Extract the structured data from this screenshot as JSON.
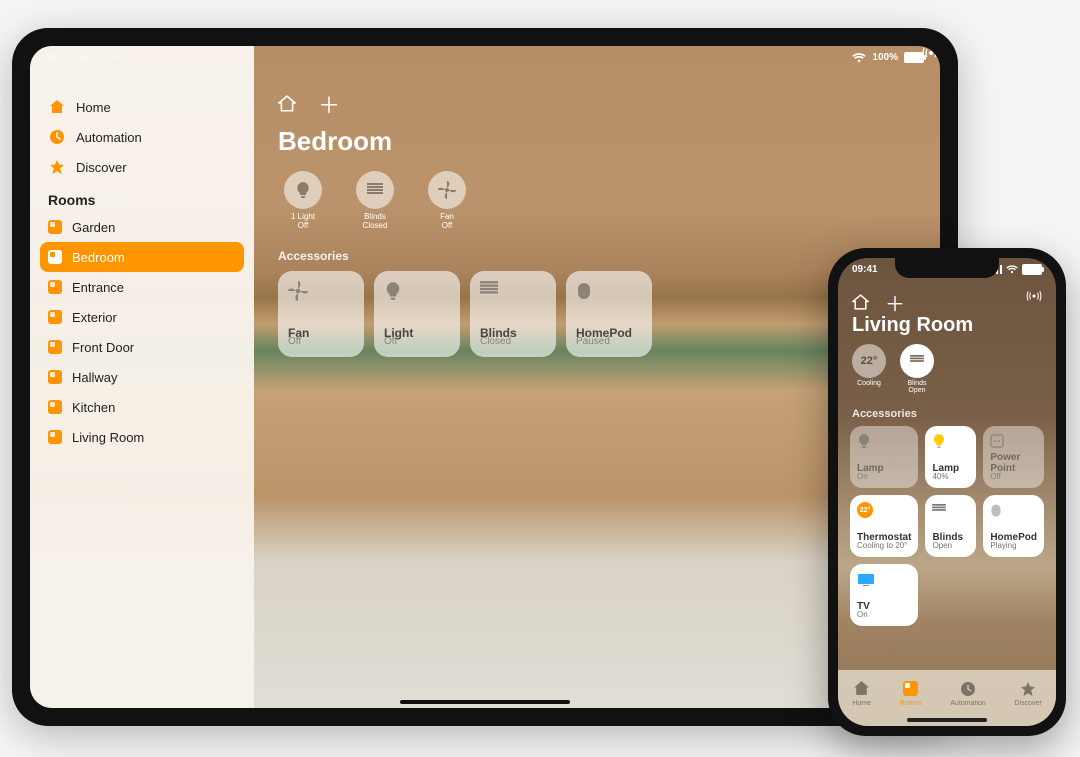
{
  "ipad": {
    "status": {
      "time": "09:41",
      "date": "Tue 13 Oct",
      "battery": "100%"
    },
    "sidebar": {
      "nav": [
        {
          "label": "Home",
          "icon": "house-icon"
        },
        {
          "label": "Automation",
          "icon": "clock-icon"
        },
        {
          "label": "Discover",
          "icon": "star-icon"
        }
      ],
      "rooms_header": "Rooms",
      "rooms": [
        {
          "label": "Garden"
        },
        {
          "label": "Bedroom",
          "selected": true
        },
        {
          "label": "Entrance"
        },
        {
          "label": "Exterior"
        },
        {
          "label": "Front Door"
        },
        {
          "label": "Hallway"
        },
        {
          "label": "Kitchen"
        },
        {
          "label": "Living Room"
        }
      ]
    },
    "main": {
      "title": "Bedroom",
      "status_circles": [
        {
          "icon": "bulb-icon",
          "label": "1 Light\nOff"
        },
        {
          "icon": "blinds-icon",
          "label": "Blinds\nClosed"
        },
        {
          "icon": "fan-icon",
          "label": "Fan\nOff"
        }
      ],
      "section_header": "Accessories",
      "tiles": [
        {
          "name": "Fan",
          "status": "Off",
          "icon": "fan-icon"
        },
        {
          "name": "Light",
          "status": "Off",
          "icon": "bulb-icon"
        },
        {
          "name": "Blinds",
          "status": "Closed",
          "icon": "blinds-icon"
        },
        {
          "name": "HomePod",
          "status": "Paused",
          "icon": "homepod-icon"
        }
      ]
    }
  },
  "iphone": {
    "status": {
      "time": "09:41"
    },
    "title": "Living Room",
    "status_circles": [
      {
        "value": "22°",
        "label": "Cooling"
      },
      {
        "icon": "blinds-icon",
        "label": "Blinds\nOpen"
      }
    ],
    "section_header": "Accessories",
    "tiles": [
      {
        "name": "Lamp",
        "status": "On",
        "state": "off",
        "icon": "bulb-icon"
      },
      {
        "name": "Lamp",
        "status": "40%",
        "state": "on",
        "icon": "bulb-on-icon",
        "accent": "#ffcc00"
      },
      {
        "name": "Power Point",
        "status": "Off",
        "state": "off",
        "icon": "outlet-icon"
      },
      {
        "name": "Thermostat",
        "status": "Cooling to 20°",
        "state": "on",
        "icon": "thermostat-icon",
        "accent": "#ff9500"
      },
      {
        "name": "Blinds",
        "status": "Open",
        "state": "on",
        "icon": "blinds-icon"
      },
      {
        "name": "HomePod",
        "status": "Playing",
        "state": "on",
        "icon": "homepod-icon"
      },
      {
        "name": "TV",
        "status": "On",
        "state": "on",
        "icon": "tv-icon",
        "accent": "#2aa8ff"
      }
    ],
    "tabs": [
      {
        "label": "Home",
        "icon": "house-icon"
      },
      {
        "label": "Rooms",
        "icon": "rooms-icon",
        "active": true
      },
      {
        "label": "Automation",
        "icon": "clock-icon"
      },
      {
        "label": "Discover",
        "icon": "star-icon"
      }
    ]
  }
}
